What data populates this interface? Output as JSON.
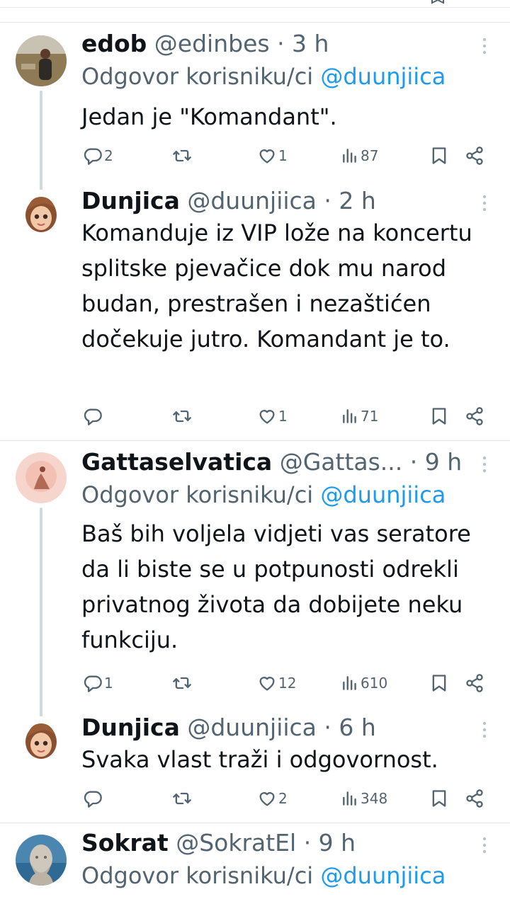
{
  "reply_prefix": "Odgovor korisniku/ci",
  "colors": {
    "text": "#0f1419",
    "secondary": "#536471",
    "link": "#1d9bf0",
    "thread": "#cfd9de"
  },
  "tweets": [
    {
      "name": "edob",
      "handle": "@edinbes",
      "time": "· 3 h",
      "reply_to": "@duunjiica",
      "text": "Jedan je \"Komandant\".",
      "replies": "2",
      "retweets": "",
      "likes": "1",
      "views": "87",
      "avatar": "photo-person"
    },
    {
      "name": "Dunjica",
      "handle": "@duunjiica",
      "time": "· 2 h",
      "reply_to": "",
      "text": "Komanduje iz VIP lože na koncertu splitske pjevačice dok mu narod budan, prestrašen i nezaštićen dočekuje jutro. Komandant je to.",
      "replies": "",
      "retweets": "",
      "likes": "1",
      "views": "71",
      "avatar": "cartoon-girl"
    },
    {
      "name": "Gattaselvatica",
      "handle": "@Gattas...",
      "time": "· 9 h",
      "reply_to": "@duunjiica",
      "text": "Baš bih voljela vidjeti vas seratore da li biste se u potpunosti odrekli privatnog života da dobijete neku funkciju.",
      "replies": "1",
      "retweets": "",
      "likes": "12",
      "views": "610",
      "avatar": "pink-art"
    },
    {
      "name": "Dunjica",
      "handle": "@duunjiica",
      "time": "· 6 h",
      "reply_to": "",
      "text": "Svaka vlast traži i odgovornost.",
      "replies": "",
      "retweets": "",
      "likes": "2",
      "views": "348",
      "avatar": "cartoon-girl"
    },
    {
      "name": "Sokrat",
      "handle": "@SokratEl",
      "time": "· 9 h",
      "reply_to": "@duunjiica",
      "text": "",
      "avatar": "statue-bust"
    }
  ],
  "icons": [
    "reply-icon",
    "retweet-icon",
    "like-icon",
    "views-icon",
    "bookmark-icon",
    "share-icon",
    "more-icon"
  ]
}
